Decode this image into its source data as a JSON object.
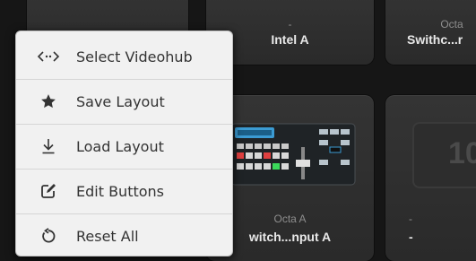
{
  "tiles": [
    {
      "sub": "-",
      "title": "Intel A"
    },
    {
      "sub": "Octa",
      "title": "Swithc...r"
    },
    {
      "sub": "Octa A",
      "title": "witch...nput A"
    },
    {
      "sub": "-",
      "title": "-"
    }
  ],
  "menu": {
    "items": [
      {
        "label": "Select Videohub",
        "icon": "code-arrows-icon"
      },
      {
        "label": "Save Layout",
        "icon": "star-icon"
      },
      {
        "label": "Load Layout",
        "icon": "download-icon"
      },
      {
        "label": "Edit Buttons",
        "icon": "edit-icon"
      },
      {
        "label": "Reset All",
        "icon": "reset-icon"
      }
    ]
  },
  "device_readout": "10"
}
